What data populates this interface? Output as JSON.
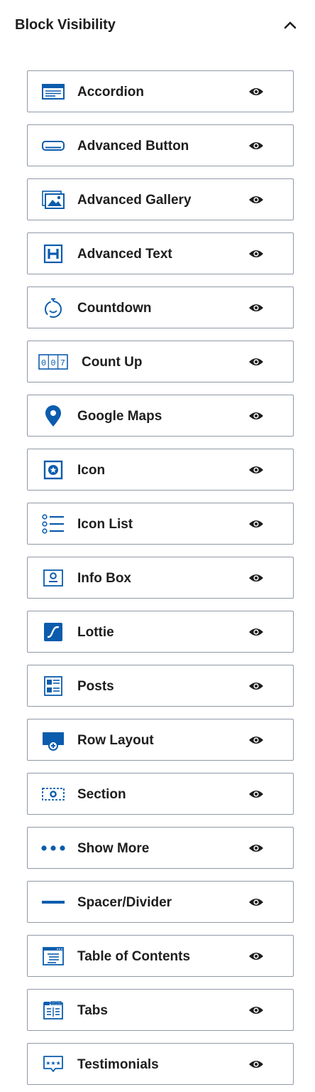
{
  "panel": {
    "title": "Block Visibility",
    "collapse_icon": "chevron-up-icon",
    "accent_color": "#0b5cad"
  },
  "blocks": [
    {
      "label": "Accordion",
      "icon": "accordion-icon",
      "visible": true
    },
    {
      "label": "Advanced Button",
      "icon": "advanced-button-icon",
      "visible": true
    },
    {
      "label": "Advanced Gallery",
      "icon": "advanced-gallery-icon",
      "visible": true
    },
    {
      "label": "Advanced Text",
      "icon": "advanced-text-icon",
      "visible": true
    },
    {
      "label": "Countdown",
      "icon": "countdown-icon",
      "visible": true
    },
    {
      "label": "Count Up",
      "icon": "count-up-icon",
      "visible": true
    },
    {
      "label": "Google Maps",
      "icon": "google-maps-icon",
      "visible": true
    },
    {
      "label": "Icon",
      "icon": "icon-block-icon",
      "visible": true
    },
    {
      "label": "Icon List",
      "icon": "icon-list-icon",
      "visible": true
    },
    {
      "label": "Info Box",
      "icon": "info-box-icon",
      "visible": true
    },
    {
      "label": "Lottie",
      "icon": "lottie-icon",
      "visible": true
    },
    {
      "label": "Posts",
      "icon": "posts-icon",
      "visible": true
    },
    {
      "label": "Row Layout",
      "icon": "row-layout-icon",
      "visible": true
    },
    {
      "label": "Section",
      "icon": "section-icon",
      "visible": true
    },
    {
      "label": "Show More",
      "icon": "show-more-icon",
      "visible": true
    },
    {
      "label": "Spacer/Divider",
      "icon": "spacer-divider-icon",
      "visible": true
    },
    {
      "label": "Table of Contents",
      "icon": "table-of-contents-icon",
      "visible": true
    },
    {
      "label": "Tabs",
      "icon": "tabs-icon",
      "visible": true
    },
    {
      "label": "Testimonials",
      "icon": "testimonials-icon",
      "visible": true
    }
  ]
}
